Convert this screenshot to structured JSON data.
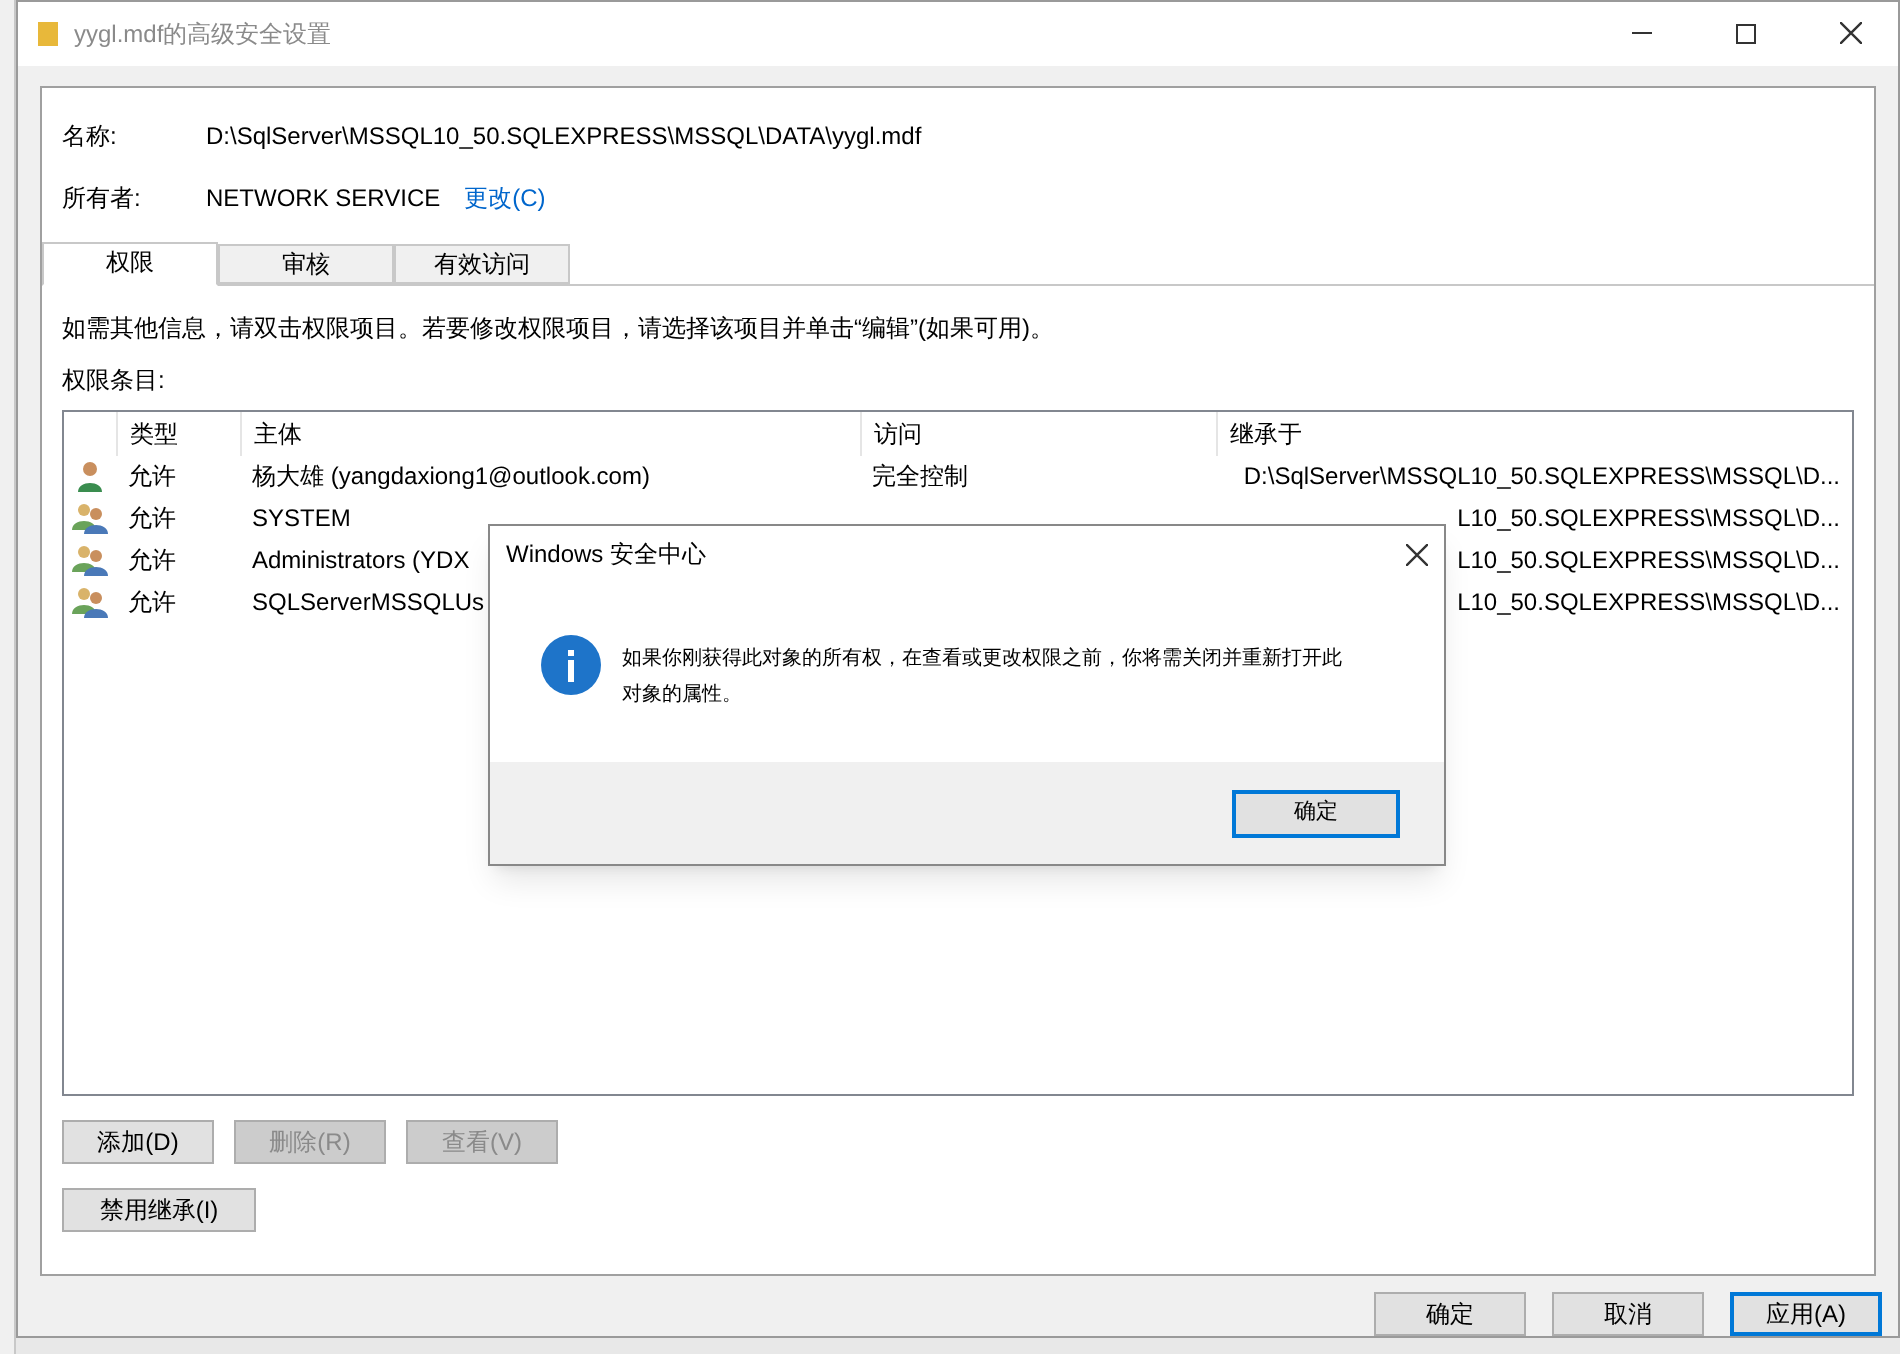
{
  "window": {
    "title": "yygl.mdf的高级安全设置"
  },
  "name": {
    "label": "名称:",
    "value": "D:\\SqlServer\\MSSQL10_50.SQLEXPRESS\\MSSQL\\DATA\\yygl.mdf"
  },
  "owner": {
    "label": "所有者:",
    "value": "NETWORK SERVICE",
    "link": "更改(C)"
  },
  "tabs": [
    {
      "label": "权限",
      "selected": true
    },
    {
      "label": "审核",
      "selected": false
    },
    {
      "label": "有效访问",
      "selected": false
    }
  ],
  "info": "如需其他信息，请双击权限项目。若要修改权限项目，请选择该项目并单击“编辑”(如果可用)。",
  "list_label": "权限条目:",
  "table": {
    "columns": [
      "类型",
      "主体",
      "访问",
      "继承于"
    ],
    "rows": [
      {
        "kind": "user",
        "type": "允许",
        "principal": "杨大雄 (yangdaxiong1@outlook.com)",
        "access": "完全控制",
        "inherited": "D:\\SqlServer\\MSSQL10_50.SQLEXPRESS\\MSSQL\\D..."
      },
      {
        "kind": "group",
        "type": "允许",
        "principal": "SYSTEM",
        "inherited": "L10_50.SQLEXPRESS\\MSSQL\\D..."
      },
      {
        "kind": "group",
        "type": "允许",
        "principal": "Administrators (YDX",
        "inherited": "L10_50.SQLEXPRESS\\MSSQL\\D..."
      },
      {
        "kind": "group",
        "type": "允许",
        "principal": "SQLServerMSSQLUs",
        "inherited": "L10_50.SQLEXPRESS\\MSSQL\\D..."
      }
    ]
  },
  "actions": [
    {
      "label": "添加(D)",
      "disabled": false
    },
    {
      "label": "删除(R)",
      "disabled": true
    },
    {
      "label": "查看(V)",
      "disabled": true
    }
  ],
  "inherit_button": {
    "label": "禁用继承(I)",
    "disabled": false
  },
  "footer_buttons": [
    {
      "label": "确定",
      "default": false
    },
    {
      "label": "取消",
      "default": false
    },
    {
      "label": "应用(A)",
      "default": true
    }
  ],
  "dialog": {
    "title": "Windows 安全中心",
    "message": "如果你刚获得此对象的所有权，在查看或更改权限之前，你将需关闭并重新打开此对象的属性。",
    "button": "确定"
  }
}
